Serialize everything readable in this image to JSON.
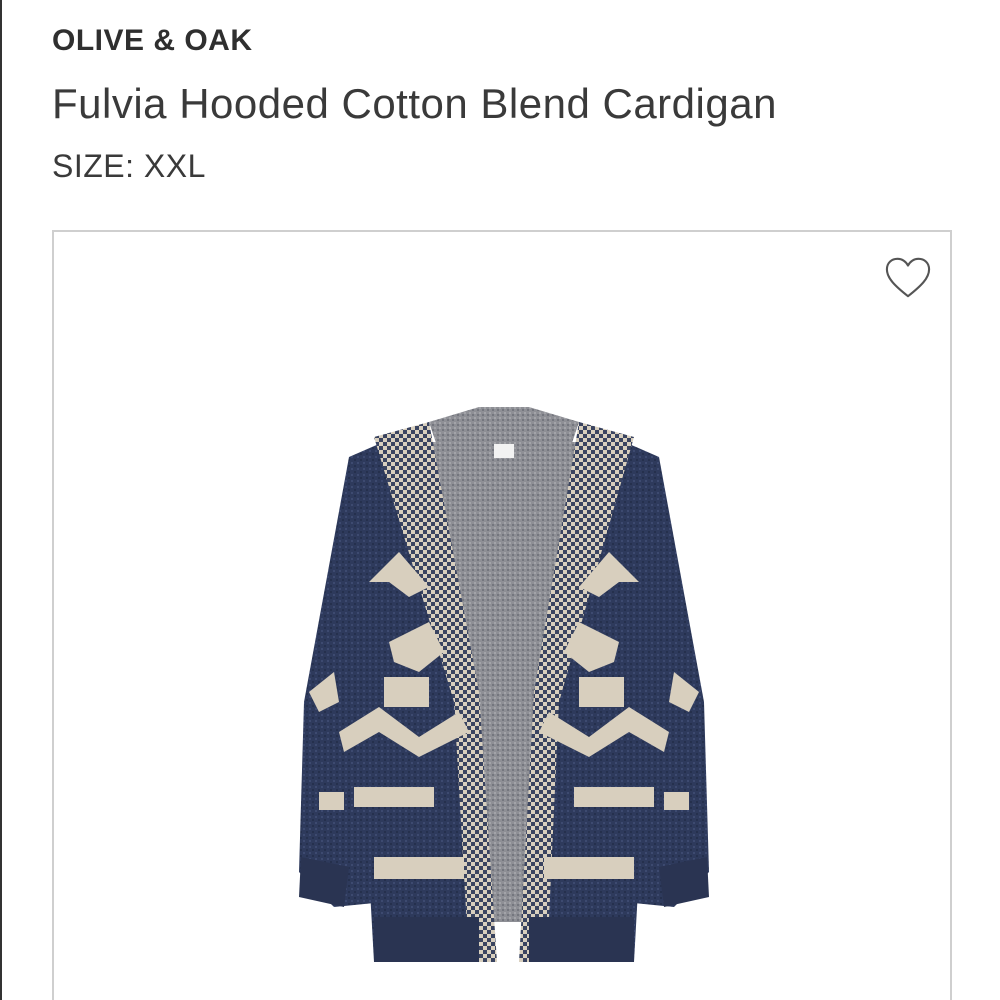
{
  "product": {
    "brand": "OLIVE & OAK",
    "name": "Fulvia Hooded Cotton Blend Cardigan",
    "size_label": "SIZE:",
    "size_value": "XXL"
  },
  "image": {
    "alt": "Fulvia Hooded Cotton Blend Cardigan",
    "favorite_icon": "heart-outline-icon"
  },
  "colors": {
    "navy_knit": "#2e3a5c",
    "cream_pattern": "#d8cfbe",
    "inner_grey": "#8c8c90",
    "border": "#cfcfcf"
  }
}
